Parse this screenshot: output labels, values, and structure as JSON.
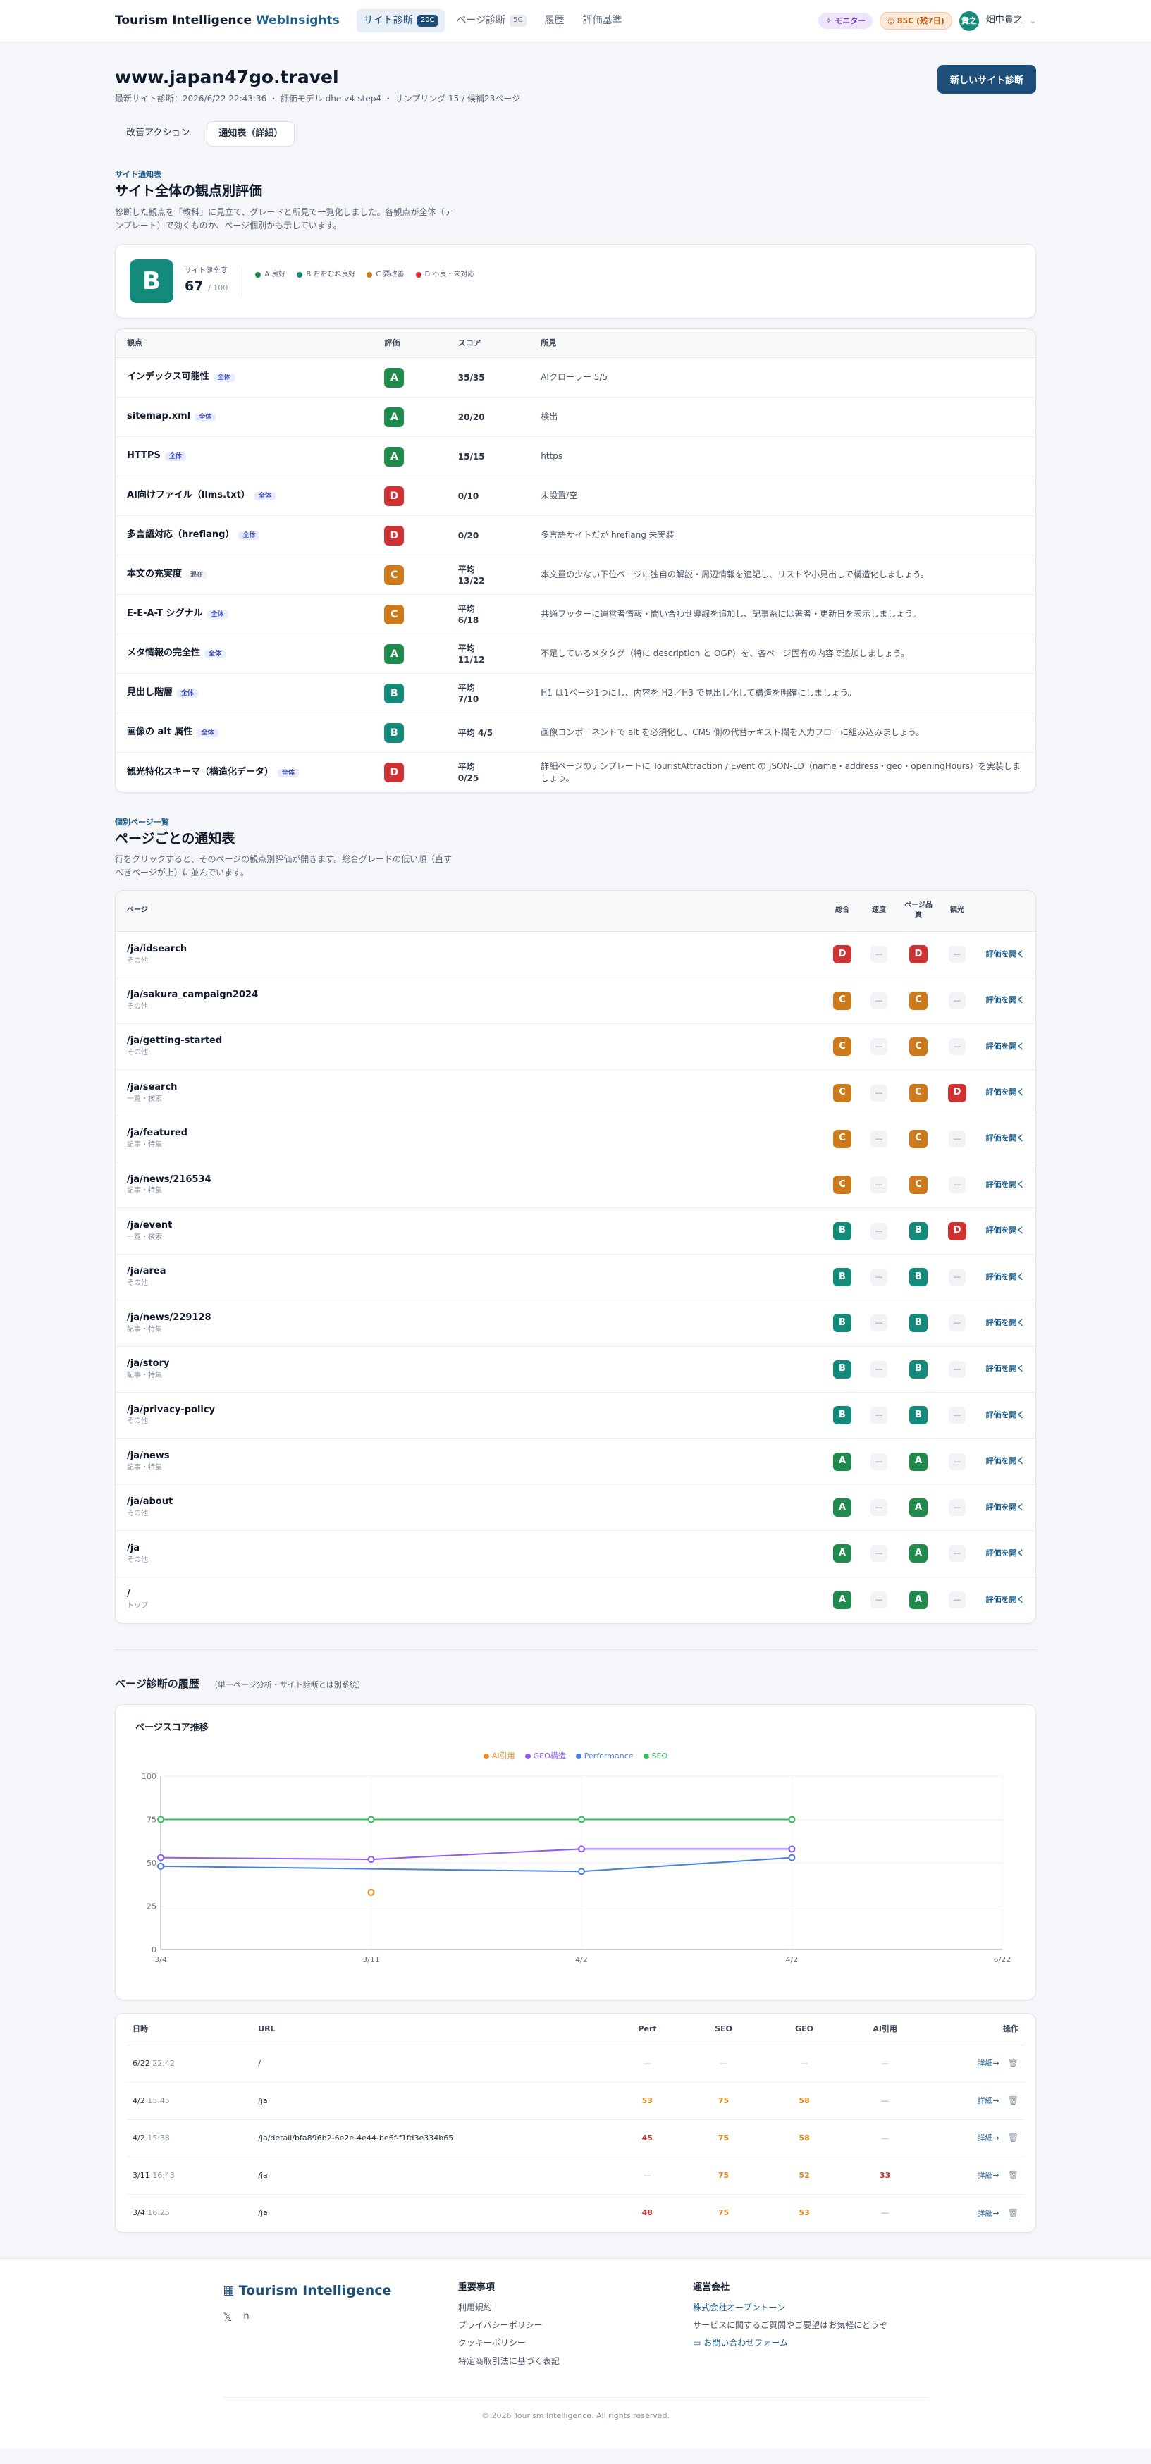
{
  "header": {
    "brand_main": "Tourism Intelligence",
    "brand_accent": "WebInsights",
    "nav": [
      {
        "label": "サイト診断",
        "badge": "20C",
        "active": true
      },
      {
        "label": "ページ診断",
        "badge": "5C",
        "active": false
      },
      {
        "label": "履歴",
        "badge": "",
        "active": false
      },
      {
        "label": "評価基準",
        "badge": "",
        "active": false
      }
    ],
    "monitor_label": "モニター",
    "credits_label": "85C (残7日)",
    "avatar_initials": "貴之",
    "user_name": "畑中貴之"
  },
  "site": {
    "domain": "www.japan47go.travel",
    "meta": "最新サイト診断：2026/6/22 22:43:36 ・ 評価モデル dhe-v4-step4 ・ サンプリング 15 / 候補23ページ",
    "new_button": "新しいサイト診断",
    "tabs": [
      "改善アクション",
      "通知表（詳細）"
    ]
  },
  "overview": {
    "eyebrow": "サイト通知表",
    "title": "サイト全体の観点別評価",
    "desc": "診断した観点を「教科」に見立て、グレードと所見で一覧化しました。各観点が全体（テンプレート）で効くものか、ページ個別かも示しています。",
    "grade": "B",
    "overall_label": "サイト健全度",
    "overall_score": "67",
    "overall_max": "/ 100",
    "legend": [
      {
        "label": "A 良好",
        "color": "#1f8a4c"
      },
      {
        "label": "B おおむね良好",
        "color": "#138a7a"
      },
      {
        "label": "C 要改善",
        "color": "#cc7a1c"
      },
      {
        "label": "D 不良・未対応",
        "color": "#cf3232"
      }
    ]
  },
  "criteria": {
    "headers": [
      "観点",
      "評価",
      "スコア",
      "所見"
    ],
    "rows": [
      {
        "name": "インデックス可能性",
        "scope": "全体",
        "scope_type": "all",
        "grade": "A",
        "score": "35/35",
        "finding": "AIクローラー 5/5"
      },
      {
        "name": "sitemap.xml",
        "scope": "全体",
        "scope_type": "all",
        "grade": "A",
        "score": "20/20",
        "finding": "検出"
      },
      {
        "name": "HTTPS",
        "scope": "全体",
        "scope_type": "all",
        "grade": "A",
        "score": "15/15",
        "finding": "https"
      },
      {
        "name": "AI向けファイル（llms.txt）",
        "scope": "全体",
        "scope_type": "all",
        "grade": "D",
        "score": "0/10",
        "finding": "未設置/空"
      },
      {
        "name": "多言語対応（hreflang）",
        "scope": "全体",
        "scope_type": "all",
        "grade": "D",
        "score": "0/20",
        "finding": "多言語サイトだが hreflang 未実装"
      },
      {
        "name": "本文の充実度",
        "scope": "混在",
        "scope_type": "mixed",
        "grade": "C",
        "score": "平均 13/22",
        "finding": "本文量の少ない下位ページに独自の解説・周辺情報を追記し、リストや小見出しで構造化しましょう。"
      },
      {
        "name": "E-E-A-T シグナル",
        "scope": "全体",
        "scope_type": "all",
        "grade": "C",
        "score": "平均 6/18",
        "finding": "共通フッターに運営者情報・問い合わせ導線を追加し、記事系には著者・更新日を表示しましょう。"
      },
      {
        "name": "メタ情報の完全性",
        "scope": "全体",
        "scope_type": "all",
        "grade": "A",
        "score": "平均 11/12",
        "finding": "不足しているメタタグ（特に description と OGP）を、各ページ固有の内容で追加しましょう。"
      },
      {
        "name": "見出し階層",
        "scope": "全体",
        "scope_type": "all",
        "grade": "B",
        "score": "平均 7/10",
        "finding": "H1 は1ページ1つにし、内容を H2／H3 で見出し化して構造を明確にしましょう。"
      },
      {
        "name": "画像の alt 属性",
        "scope": "全体",
        "scope_type": "all",
        "grade": "B",
        "score": "平均 4/5",
        "finding": "画像コンポーネントで alt を必須化し、CMS 側の代替テキスト欄を入力フローに組み込みましょう。"
      },
      {
        "name": "観光特化スキーマ（構造化データ）",
        "scope": "全体",
        "scope_type": "all",
        "grade": "D",
        "score": "平均 0/25",
        "finding": "詳細ページのテンプレートに TouristAttraction / Event の JSON-LD（name・address・geo・openingHours）を実装しましょう。"
      }
    ]
  },
  "pages": {
    "eyebrow": "個別ページ一覧",
    "title": "ページごとの通知表",
    "desc": "行をクリックすると、そのページの観点別評価が開きます。総合グレードの低い順（直すべきページが上）に並んでいます。",
    "headers": {
      "page": "ページ",
      "overall": "総合",
      "speed": "速度",
      "quality": "ページ品質",
      "tourism": "観光"
    },
    "open_label": "評価を開く",
    "rows": [
      {
        "path": "/ja/idsearch",
        "type": "その他",
        "overall": "D",
        "speed": "—",
        "quality": "D",
        "tourism": "—"
      },
      {
        "path": "/ja/sakura_campaign2024",
        "type": "その他",
        "overall": "C",
        "speed": "—",
        "quality": "C",
        "tourism": "—"
      },
      {
        "path": "/ja/getting-started",
        "type": "その他",
        "overall": "C",
        "speed": "—",
        "quality": "C",
        "tourism": "—"
      },
      {
        "path": "/ja/search",
        "type": "一覧・検索",
        "overall": "C",
        "speed": "—",
        "quality": "C",
        "tourism": "D"
      },
      {
        "path": "/ja/featured",
        "type": "記事・特集",
        "overall": "C",
        "speed": "—",
        "quality": "C",
        "tourism": "—"
      },
      {
        "path": "/ja/news/216534",
        "type": "記事・特集",
        "overall": "C",
        "speed": "—",
        "quality": "C",
        "tourism": "—"
      },
      {
        "path": "/ja/event",
        "type": "一覧・検索",
        "overall": "B",
        "speed": "—",
        "quality": "B",
        "tourism": "D"
      },
      {
        "path": "/ja/area",
        "type": "その他",
        "overall": "B",
        "speed": "—",
        "quality": "B",
        "tourism": "—"
      },
      {
        "path": "/ja/news/229128",
        "type": "記事・特集",
        "overall": "B",
        "speed": "—",
        "quality": "B",
        "tourism": "—"
      },
      {
        "path": "/ja/story",
        "type": "記事・特集",
        "overall": "B",
        "speed": "—",
        "quality": "B",
        "tourism": "—"
      },
      {
        "path": "/ja/privacy-policy",
        "type": "その他",
        "overall": "B",
        "speed": "—",
        "quality": "B",
        "tourism": "—"
      },
      {
        "path": "/ja/news",
        "type": "記事・特集",
        "overall": "A",
        "speed": "—",
        "quality": "A",
        "tourism": "—"
      },
      {
        "path": "/ja/about",
        "type": "その他",
        "overall": "A",
        "speed": "—",
        "quality": "A",
        "tourism": "—"
      },
      {
        "path": "/ja",
        "type": "その他",
        "overall": "A",
        "speed": "—",
        "quality": "A",
        "tourism": "—"
      },
      {
        "path": "/",
        "type": "トップ",
        "overall": "A",
        "speed": "—",
        "quality": "A",
        "tourism": "—"
      }
    ]
  },
  "history": {
    "title": "ページ診断の履歴",
    "subtitle": "（単一ページ分析・サイト診断とは別系統）",
    "chart_title": "ページスコア推移",
    "headers": [
      "日時",
      "URL",
      "Perf",
      "SEO",
      "GEO",
      "AI引用",
      "操作"
    ],
    "detail_label": "詳細→",
    "rows": [
      {
        "date": "6/22",
        "time": "22:42",
        "url": "/",
        "perf": "—",
        "seo": "—",
        "geo": "—",
        "ai": "—"
      },
      {
        "date": "4/2",
        "time": "15:45",
        "url": "/ja",
        "perf": "53",
        "seo": "75",
        "geo": "58",
        "ai": "—"
      },
      {
        "date": "4/2",
        "time": "15:38",
        "url": "/ja/detail/bfa896b2-6e2e-4e44-be6f-f1fd3e334b65",
        "perf": "45",
        "seo": "75",
        "geo": "58",
        "ai": "—"
      },
      {
        "date": "3/11",
        "time": "16:43",
        "url": "/ja",
        "perf": "—",
        "seo": "75",
        "geo": "52",
        "ai": "33"
      },
      {
        "date": "3/4",
        "time": "16:25",
        "url": "/ja",
        "perf": "48",
        "seo": "75",
        "geo": "53",
        "ai": "—"
      }
    ]
  },
  "chart_data": {
    "type": "line",
    "title": "ページスコア推移",
    "categories": [
      "3/4",
      "3/11",
      "4/2",
      "4/2",
      "6/22"
    ],
    "ylim": [
      0,
      100
    ],
    "yticks": [
      0,
      25,
      50,
      75,
      100
    ],
    "grid": true,
    "legend_position": "top",
    "series": [
      {
        "name": "AI引用",
        "color": "#f08a24",
        "values": [
          null,
          33,
          null,
          null,
          null
        ]
      },
      {
        "name": "GEO構造",
        "color": "#8b5cf6",
        "values": [
          53,
          52,
          58,
          58,
          null
        ]
      },
      {
        "name": "Performance",
        "color": "#4a7fe0",
        "values": [
          48,
          null,
          45,
          53,
          null
        ]
      },
      {
        "name": "SEO",
        "color": "#2fbf5a",
        "values": [
          75,
          75,
          75,
          75,
          null
        ]
      }
    ]
  },
  "footer": {
    "logo": "Tourism Intelligence",
    "social_x": "𝕏",
    "social_n": "n",
    "col2_title": "重要事項",
    "col2_links": [
      "利用規約",
      "プライバシーポリシー",
      "クッキーポリシー",
      "特定商取引法に基づく表記"
    ],
    "col3_title": "運営会社",
    "company": "株式会社オープントーン",
    "contact_text": "サービスに関するご質問やご要望はお気軽にどうぞ",
    "contact_link": "お問い合わせフォーム",
    "copyright": "© 2026 Tourism Intelligence. All rights reserved."
  }
}
